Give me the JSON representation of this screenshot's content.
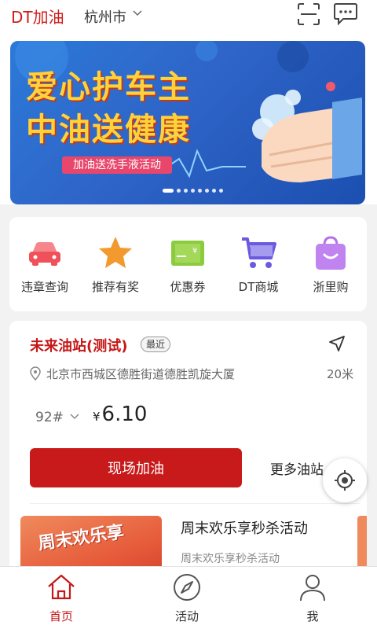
{
  "header": {
    "brand": "DT加油",
    "city": "杭州市",
    "icons": [
      "scan-icon",
      "message-icon"
    ]
  },
  "banner": {
    "title_line1": "爱心护车主",
    "title_line2": "中油送健康",
    "subtitle": "加油送洗手液活动",
    "page_count": 8,
    "active_page": 0
  },
  "quick_menu": [
    {
      "label": "违章查询",
      "icon": "car-icon",
      "color": "#f0505a"
    },
    {
      "label": "推荐有奖",
      "icon": "star-icon",
      "color": "#f39a2e"
    },
    {
      "label": "优惠券",
      "icon": "coupon-icon",
      "color": "#8ccc3c"
    },
    {
      "label": "DT商城",
      "icon": "cart-icon",
      "color": "#6a5ae0"
    },
    {
      "label": "浙里购",
      "icon": "shopping-bag-icon",
      "color": "#b870e8"
    }
  ],
  "station": {
    "name": "未来油站(测试)",
    "badge": "最近",
    "address": "北京市西城区德胜街道德胜凯旋大厦",
    "distance": "20米",
    "fuel_grade": "92#",
    "currency": "¥",
    "price": "6.10",
    "primary_button": "现场加油",
    "secondary_link": "更多油站"
  },
  "promo": {
    "image_text": "周末欢乐享",
    "title": "周末欢乐享秒杀活动",
    "subtitle": "周末欢乐享秒杀活动"
  },
  "bottom_nav": [
    {
      "label": "首页",
      "icon": "home-icon",
      "active": true
    },
    {
      "label": "活动",
      "icon": "compass-icon",
      "active": false
    },
    {
      "label": "我",
      "icon": "user-icon",
      "active": false
    }
  ],
  "colors": {
    "brand_red": "#c81a1a",
    "banner_blue": "#2b7ad8",
    "banner_yellow": "#ffd23a"
  }
}
